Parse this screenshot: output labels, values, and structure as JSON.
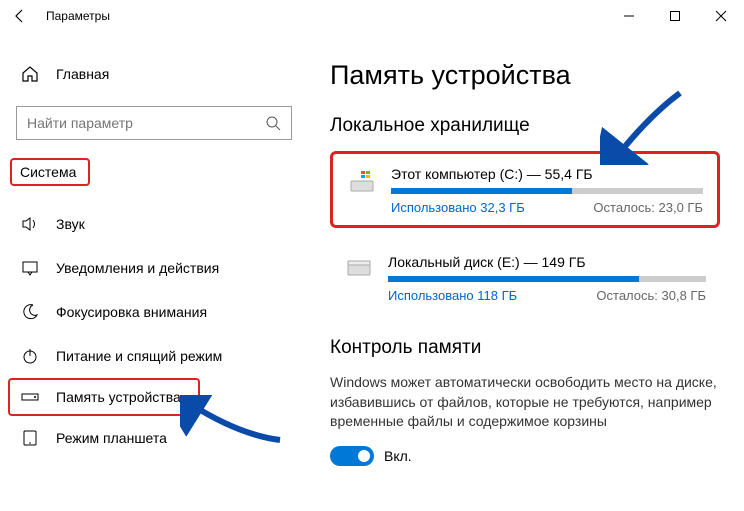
{
  "window": {
    "title": "Параметры"
  },
  "sidebar": {
    "home": "Главная",
    "search_placeholder": "Найти параметр",
    "section": "Система",
    "items": [
      {
        "label": "Звук"
      },
      {
        "label": "Уведомления и действия"
      },
      {
        "label": "Фокусировка внимания"
      },
      {
        "label": "Питание и спящий режим"
      },
      {
        "label": "Память устройства"
      },
      {
        "label": "Режим планшета"
      }
    ]
  },
  "main": {
    "title": "Память устройства",
    "local_storage": "Локальное хранилище",
    "drives": [
      {
        "name": "Этот компьютер (C:) — 55,4 ГБ",
        "used": "Использовано 32,3 ГБ",
        "free": "Осталось: 23,0 ГБ",
        "fill_pct": 58
      },
      {
        "name": "Локальный диск (E:) — 149 ГБ",
        "used": "Использовано 118 ГБ",
        "free": "Осталось: 30,8 ГБ",
        "fill_pct": 79
      }
    ],
    "sense_title": "Контроль памяти",
    "sense_desc": "Windows может автоматически освободить место на диске, избавившись от файлов, которые не требуются, например временные файлы и содержимое корзины",
    "toggle_label": "Вкл."
  }
}
